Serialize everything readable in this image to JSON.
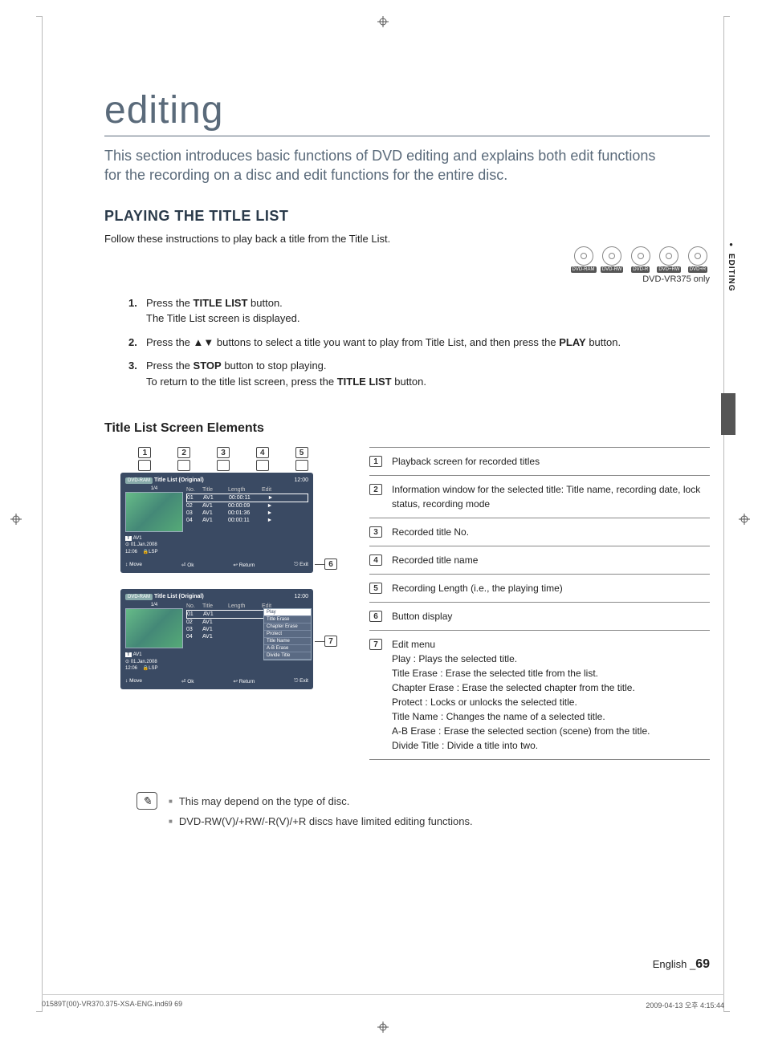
{
  "chapter": "editing",
  "intro": "This section introduces basic functions of DVD editing and explains both edit functions for the recording on a disc and edit functions for the entire disc.",
  "section_title": "PLAYING THE TITLE LIST",
  "section_instr": "Follow these instructions to play back a title from the Title List.",
  "discs": [
    "DVD-RAM",
    "DVD-RW",
    "DVD-R",
    "DVD+RW",
    "DVD+R"
  ],
  "disc_note": "DVD-VR375 only",
  "steps": [
    {
      "n": "1.",
      "a": "Press the ",
      "b": "TITLE LIST",
      "c": " button.",
      "d": "The Title List screen is displayed."
    },
    {
      "n": "2.",
      "a": "Press the ▲▼ buttons to select a title you want to play from Title List, and then press the ",
      "b": "PLAY",
      "c": " button.",
      "d": ""
    },
    {
      "n": "3.",
      "a": "Press the ",
      "b": "STOP",
      "c": " button to stop playing.",
      "d_a": "To return to the title list screen, press the ",
      "d_b": "TITLE LIST",
      "d_c": " button."
    }
  ],
  "subsection": "Title List Screen Elements",
  "callouts_top": [
    "1",
    "2",
    "3",
    "4",
    "5"
  ],
  "callout_6": "6",
  "callout_7": "7",
  "osd": {
    "ram_label": "DVD-RAM",
    "title": "Title List (Original)",
    "clock": "12:00",
    "counter": "1/4",
    "th": {
      "no": "No.",
      "title": "Title",
      "length": "Length",
      "edit": "Edit"
    },
    "rows": [
      {
        "no": "01",
        "title": "AV1",
        "length": "00:00:11",
        "edit": "►"
      },
      {
        "no": "02",
        "title": "AV1",
        "length": "00:00:09",
        "edit": "►"
      },
      {
        "no": "03",
        "title": "AV1",
        "length": "00:01:36",
        "edit": "►"
      },
      {
        "no": "04",
        "title": "AV1",
        "length": "00:00:11",
        "edit": "►"
      }
    ],
    "info": {
      "src": "AV1",
      "date": "01.Jan.2008",
      "time": "12:06",
      "mode": "LSP",
      "tv": "T"
    },
    "footer": {
      "move": "Move",
      "ok": "Ok",
      "ret": "Return",
      "exit": "Exit",
      "move_sym": "↕",
      "ok_sym": "⏎",
      "ret_sym": "↩",
      "exit_sym": "⎋"
    },
    "menu": [
      "Play",
      "Title Erase",
      "Chapter Erase",
      "Protect",
      "Title Name",
      "A-B Erase",
      "Divide Title"
    ]
  },
  "legend": [
    {
      "k": "1",
      "t": "Playback screen for recorded titles"
    },
    {
      "k": "2",
      "t": "Information window for the selected title: Title name, recording date, lock status, recording mode"
    },
    {
      "k": "3",
      "t": "Recorded title No."
    },
    {
      "k": "4",
      "t": "Recorded title name"
    },
    {
      "k": "5",
      "t": "Recording Length (i.e., the playing time)"
    },
    {
      "k": "6",
      "t": "Button display"
    },
    {
      "k": "7",
      "hdr": "Edit menu",
      "lines": [
        "Play : Plays the selected title.",
        "Title Erase : Erase the selected title from the list.",
        "Chapter Erase : Erase the selected chapter from the title.",
        "Protect : Locks or unlocks the selected title.",
        "Title Name : Changes the name of a selected title.",
        "A-B Erase : Erase the selected section (scene) from the title.",
        "Divide Title : Divide a title into two."
      ]
    }
  ],
  "notes": [
    "This may depend on the type of disc.",
    "DVD-RW(V)/+RW/-R(V)/+R discs have limited editing functions."
  ],
  "side_tab": "EDITING",
  "page_lang": "English _",
  "page_num": "69",
  "foot_left": "01589T(00)-VR370.375-XSA-ENG.ind69   69",
  "foot_right": "2009-04-13   오후 4:15:44"
}
